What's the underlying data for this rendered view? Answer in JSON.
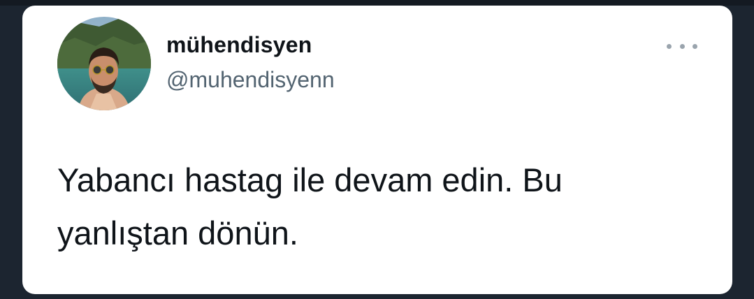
{
  "tweet": {
    "author": {
      "display_name": "mühendisyen",
      "handle": "@muhendisyenn",
      "avatar_icon": "profile-photo"
    },
    "more_icon": "more-horizontal-icon",
    "text": "Yabancı hastag ile devam edin. Bu\nyanlıştan dönün."
  },
  "colors": {
    "card_background": "#ffffff",
    "page_background": "#1c2530",
    "name_color": "#0f1419",
    "handle_color": "#536471"
  }
}
